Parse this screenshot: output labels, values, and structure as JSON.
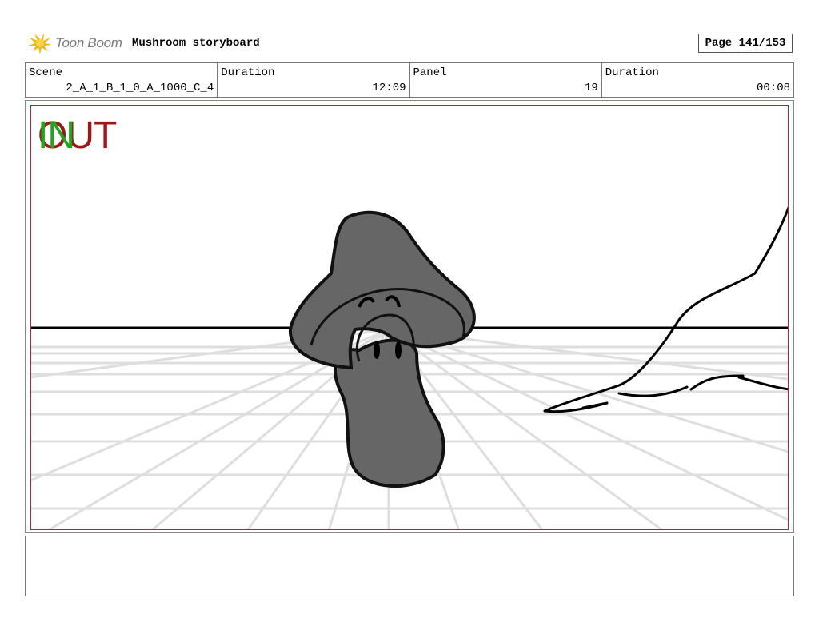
{
  "header": {
    "logo_text": "Toon Boom",
    "title": "Mushroom storyboard",
    "page": "Page 141/153"
  },
  "info": {
    "scene_label": "Scene",
    "scene_value": "2_A_1_B_1_0_A_1000_C_4",
    "scene_duration_label": "Duration",
    "scene_duration_value": "12:09",
    "panel_label": "Panel",
    "panel_value": "19",
    "panel_duration_label": "Duration",
    "panel_duration_value": "00:08"
  },
  "panel": {
    "marker_out": "OUT",
    "marker_in": "IN",
    "colors": {
      "frame": "#b5252b",
      "out_marker": "#9a1a1a",
      "in_marker": "#1fa51f",
      "mushroom": "#666666"
    }
  },
  "notes": {
    "text": ""
  }
}
